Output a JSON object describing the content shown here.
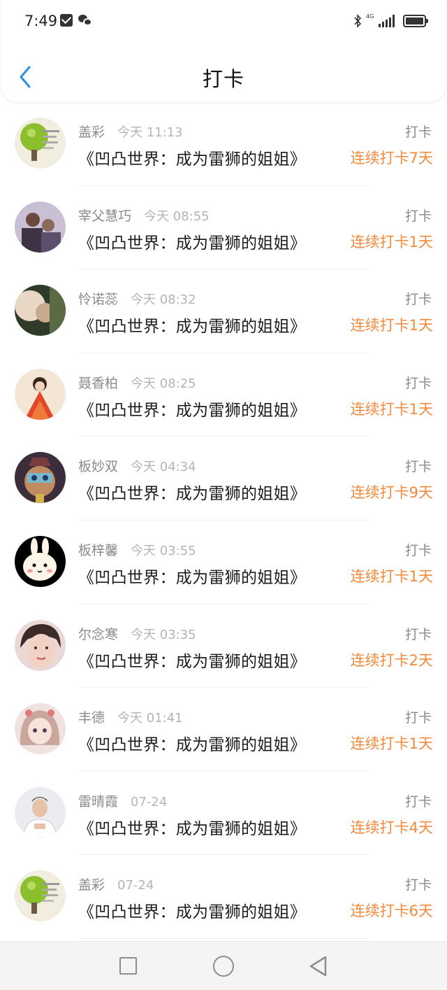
{
  "status_bar": {
    "time": "7:49",
    "network": "4G"
  },
  "header": {
    "title": "打卡"
  },
  "items": [
    {
      "name": "盖彩",
      "time": "今天 11:13",
      "book": "《凹凸世界：成为雷狮的姐姐》",
      "tag": "打卡",
      "streak": "连续打卡7天",
      "avatar": "lime-avatar"
    },
    {
      "name": "宰父慧巧",
      "time": "今天 08:55",
      "book": "《凹凸世界：成为雷狮的姐姐》",
      "tag": "打卡",
      "streak": "连续打卡1天",
      "avatar": "group-photo-avatar"
    },
    {
      "name": "怜诺蕊",
      "time": "今天 08:32",
      "book": "《凹凸世界：成为雷狮的姐姐》",
      "tag": "打卡",
      "streak": "连续打卡1天",
      "avatar": "portrait-avatar"
    },
    {
      "name": "聂香柏",
      "time": "今天 08:25",
      "book": "《凹凸世界：成为雷狮的姐姐》",
      "tag": "打卡",
      "streak": "连续打卡1天",
      "avatar": "doll-avatar"
    },
    {
      "name": "板妙双",
      "time": "今天 04:34",
      "book": "《凹凸世界：成为雷狮的姐姐》",
      "tag": "打卡",
      "streak": "连续打卡9天",
      "avatar": "anime-avatar"
    },
    {
      "name": "板梓馨",
      "time": "今天 03:55",
      "book": "《凹凸世界：成为雷狮的姐姐》",
      "tag": "打卡",
      "streak": "连续打卡1天",
      "avatar": "bunny-avatar"
    },
    {
      "name": "尔念寒",
      "time": "今天 03:35",
      "book": "《凹凸世界：成为雷狮的姐姐》",
      "tag": "打卡",
      "streak": "连续打卡2天",
      "avatar": "face-avatar"
    },
    {
      "name": "丰德",
      "time": "今天 01:41",
      "book": "《凹凸世界：成为雷狮的姐姐》",
      "tag": "打卡",
      "streak": "连续打卡1天",
      "avatar": "anime-girl-avatar"
    },
    {
      "name": "雷晴霞",
      "time": "07-24",
      "book": "《凹凸世界：成为雷狮的姐姐》",
      "tag": "打卡",
      "streak": "连续打卡4天",
      "avatar": "man-avatar"
    },
    {
      "name": "盖彩",
      "time": "07-24",
      "book": "《凹凸世界：成为雷狮的姐姐》",
      "tag": "打卡",
      "streak": "连续打卡6天",
      "avatar": "lime-avatar"
    }
  ],
  "colors": {
    "accent": "#f08a3c",
    "back_arrow": "#2a8ee8"
  }
}
